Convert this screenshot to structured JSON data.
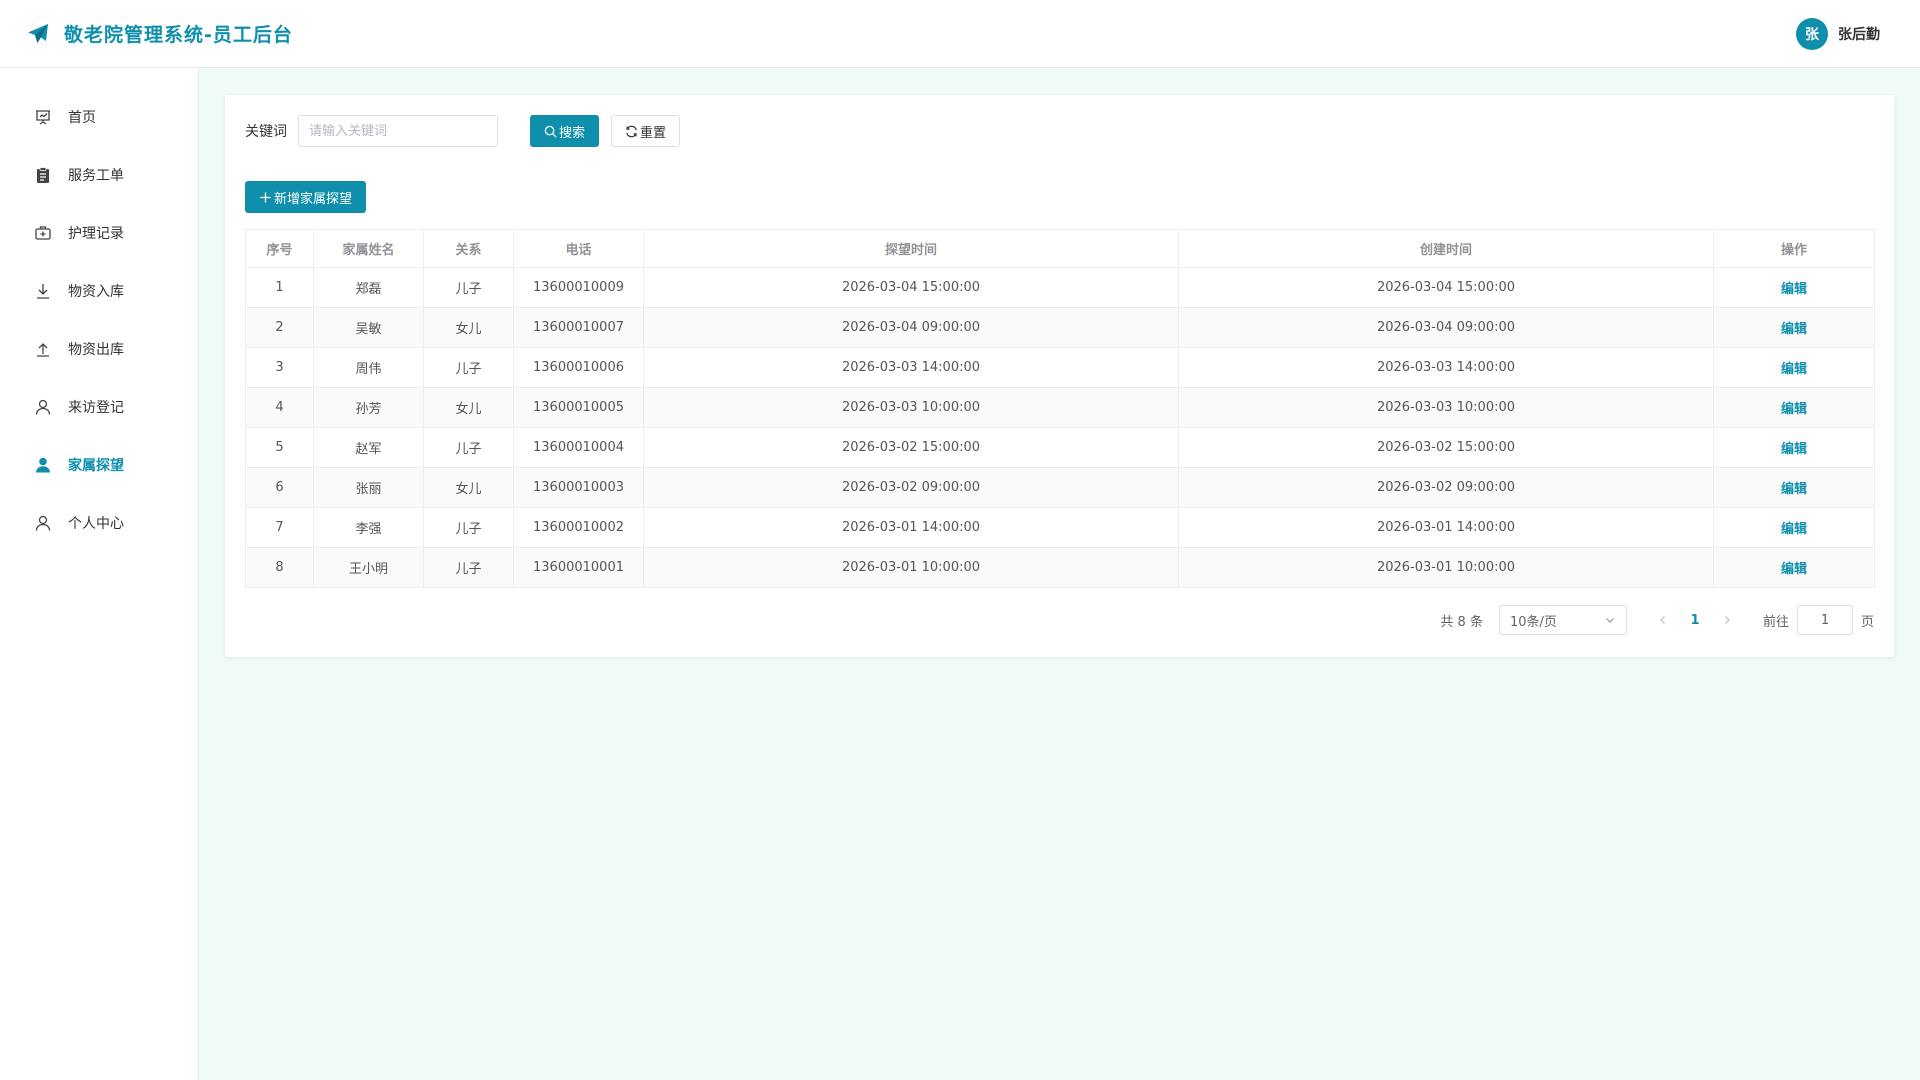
{
  "header": {
    "title": "敬老院管理系统-员工后台",
    "brand_icon": "paper-plane-icon",
    "user": {
      "avatar_text": "张",
      "name": "张后勤"
    }
  },
  "colors": {
    "brand": "#0f8fab",
    "background": "#f0fbf9"
  },
  "sidebar": {
    "items": [
      {
        "label": "首页",
        "icon": "presentation-icon",
        "active": false
      },
      {
        "label": "服务工单",
        "icon": "clipboard-icon",
        "active": false
      },
      {
        "label": "护理记录",
        "icon": "first-aid-icon",
        "active": false
      },
      {
        "label": "物资入库",
        "icon": "download-icon",
        "active": false
      },
      {
        "label": "物资出库",
        "icon": "upload-icon",
        "active": false
      },
      {
        "label": "来访登记",
        "icon": "user-icon",
        "active": false
      },
      {
        "label": "家属探望",
        "icon": "user-filled-icon",
        "active": true
      },
      {
        "label": "个人中心",
        "icon": "user-icon",
        "active": false
      }
    ]
  },
  "search": {
    "label": "关键词",
    "placeholder": "请输入关键词",
    "value": "",
    "search_label": "搜索",
    "reset_label": "重置"
  },
  "toolbar": {
    "add_label": "新增家属探望"
  },
  "table": {
    "columns": [
      "序号",
      "家属姓名",
      "关系",
      "电话",
      "探望时间",
      "创建时间",
      "操作"
    ],
    "rows": [
      {
        "index": "1",
        "name": "郑磊",
        "relation": "儿子",
        "phone": "13600010009",
        "visit_time": "2026-03-04 15:00:00",
        "created_time": "2026-03-04 15:00:00",
        "action": "编辑"
      },
      {
        "index": "2",
        "name": "吴敏",
        "relation": "女儿",
        "phone": "13600010007",
        "visit_time": "2026-03-04 09:00:00",
        "created_time": "2026-03-04 09:00:00",
        "action": "编辑"
      },
      {
        "index": "3",
        "name": "周伟",
        "relation": "儿子",
        "phone": "13600010006",
        "visit_time": "2026-03-03 14:00:00",
        "created_time": "2026-03-03 14:00:00",
        "action": "编辑"
      },
      {
        "index": "4",
        "name": "孙芳",
        "relation": "女儿",
        "phone": "13600010005",
        "visit_time": "2026-03-03 10:00:00",
        "created_time": "2026-03-03 10:00:00",
        "action": "编辑"
      },
      {
        "index": "5",
        "name": "赵军",
        "relation": "儿子",
        "phone": "13600010004",
        "visit_time": "2026-03-02 15:00:00",
        "created_time": "2026-03-02 15:00:00",
        "action": "编辑"
      },
      {
        "index": "6",
        "name": "张丽",
        "relation": "女儿",
        "phone": "13600010003",
        "visit_time": "2026-03-02 09:00:00",
        "created_time": "2026-03-02 09:00:00",
        "action": "编辑"
      },
      {
        "index": "7",
        "name": "李强",
        "relation": "儿子",
        "phone": "13600010002",
        "visit_time": "2026-03-01 14:00:00",
        "created_time": "2026-03-01 14:00:00",
        "action": "编辑"
      },
      {
        "index": "8",
        "name": "王小明",
        "relation": "儿子",
        "phone": "13600010001",
        "visit_time": "2026-03-01 10:00:00",
        "created_time": "2026-03-01 10:00:00",
        "action": "编辑"
      }
    ]
  },
  "pagination": {
    "total_label": "共 8 条",
    "page_size": "10条/页",
    "current_page": "1",
    "goto_label": "前往",
    "goto_value": "1",
    "page_unit": "页"
  }
}
